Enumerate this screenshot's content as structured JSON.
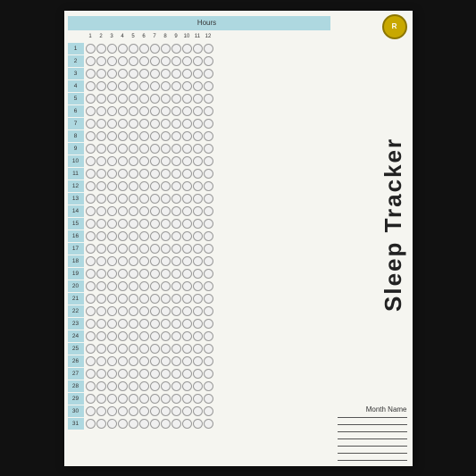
{
  "title": "Sleep Tracker",
  "header": {
    "hours_label": "Hours"
  },
  "hours": [
    1,
    2,
    3,
    4,
    5,
    6,
    7,
    8,
    9,
    10,
    11,
    12
  ],
  "days": [
    1,
    2,
    3,
    4,
    5,
    6,
    7,
    8,
    9,
    10,
    11,
    12,
    13,
    14,
    15,
    16,
    17,
    18,
    19,
    20,
    21,
    22,
    23,
    24,
    25,
    26,
    27,
    28,
    29,
    30,
    31
  ],
  "month_label": "Month Name",
  "logo_text": "R",
  "colors": {
    "header_bg": "#aed8e0",
    "circle_border": "#999",
    "circle_fill": "#f0f0f0",
    "day_bg": "#aed8e0",
    "logo_bg": "#c8a800"
  }
}
